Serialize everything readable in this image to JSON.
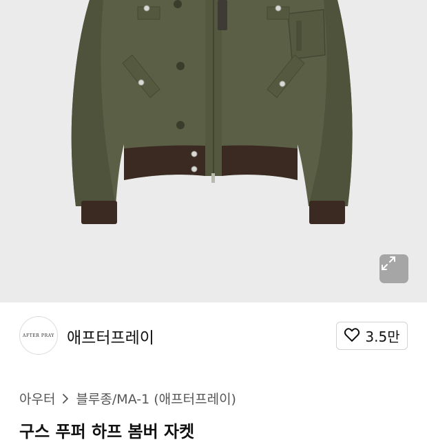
{
  "brand": {
    "logo_text": "AFTER PRAY",
    "name": "애프터프레이"
  },
  "like": {
    "count": "3.5만"
  },
  "breadcrumb": {
    "category": "아우터",
    "subcategory": "블루종/MA-1 (애프터프레이)"
  },
  "product": {
    "title": "구스 푸퍼 하프 봄버 자켓"
  },
  "colors": {
    "hero_bg": "#ebebeb",
    "jacket_olive": "#5b5f46",
    "rib_brown": "#3a2a22"
  },
  "icons": {
    "expand": "expand-arrows-icon",
    "like": "heart-outline-icon",
    "chevron": "chevron-right-icon"
  }
}
